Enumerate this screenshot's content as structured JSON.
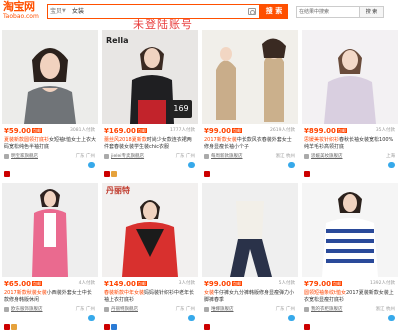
{
  "header": {
    "logo_cn": "淘宝网",
    "logo_en": "Taobao.com",
    "search_category": "宝贝",
    "search_query": "女装",
    "search_button": "搜 索",
    "search_store_placeholder": "在结果中搜索",
    "search_store_button": "搜 索"
  },
  "watermark": "未登陆账号",
  "overlay": {
    "brand1": "Rella",
    "price_badge": "169",
    "brand2": "丹丽特"
  },
  "items": [
    {
      "price": "¥59.00",
      "tag": "包邮",
      "sales": "3081人付款",
      "title_a": "夏装新款圆领打底衫",
      "title_b": "女短袖t恤女士上衣大码宽松纯色半袖打底",
      "shop": "明宝家旗舰店",
      "loc": "广东 广州"
    },
    {
      "price": "¥169.00",
      "tag": "包邮",
      "sales": "1777人付款",
      "title_a": "蕾丝风2018夏新款",
      "title_b": "时尚少女款连衣裙两件套春装女装学生装chic衣服",
      "shop": "jielei专卖旗舰店",
      "loc": "广东 广州"
    },
    {
      "price": "¥99.00",
      "tag": "包邮",
      "sales": "2619人付款",
      "title_a": "2017新款女装",
      "title_b": "中长款风衣春装外套女士修身显瘦长袖小个子",
      "shop": "每周新款旗舰店",
      "loc": "浙江 杭州"
    },
    {
      "price": "¥899.00",
      "tag": "包邮",
      "sales": "35人付款",
      "title_a": "思媛美妆针织衫",
      "title_b": "春秋长袖女装宽松100%纯羊毛衫高领打底",
      "shop": "思媛美妆旗舰店",
      "loc": "上海"
    },
    {
      "price": "¥65.00",
      "tag": "包邮",
      "sales": "4人付款",
      "title_a": "2017新款秋装女装",
      "title_b": "小西装外套女士中长款修身韩版休闲",
      "shop": "欧东服饰旗舰店",
      "loc": "广东 广州"
    },
    {
      "price": "¥149.00",
      "tag": "包邮",
      "sales": "3人付款",
      "title_a": "春装新款中年女装",
      "title_b": "妈妈装针织衫中老年长袖上衣打底衫",
      "shop": "丹丽特旗舰店",
      "loc": "广东 广州"
    },
    {
      "price": "¥99.00",
      "tag": "包邮",
      "sales": "5人付款",
      "title_a": "女装",
      "title_b": "牛仔裤女九分裤韩版修身显瘦弹力小脚裤春季",
      "shop": "唯娜旗舰店",
      "loc": "广东 广州"
    },
    {
      "price": "¥79.00",
      "tag": "包邮",
      "sales": "1392人付款",
      "title_a": "圆领短袖条纹t恤女",
      "title_b": "2017夏装新款女装上衣宽松显瘦打底衫",
      "shop": "我的衣柜旗舰店",
      "loc": "浙江 杭州"
    }
  ]
}
